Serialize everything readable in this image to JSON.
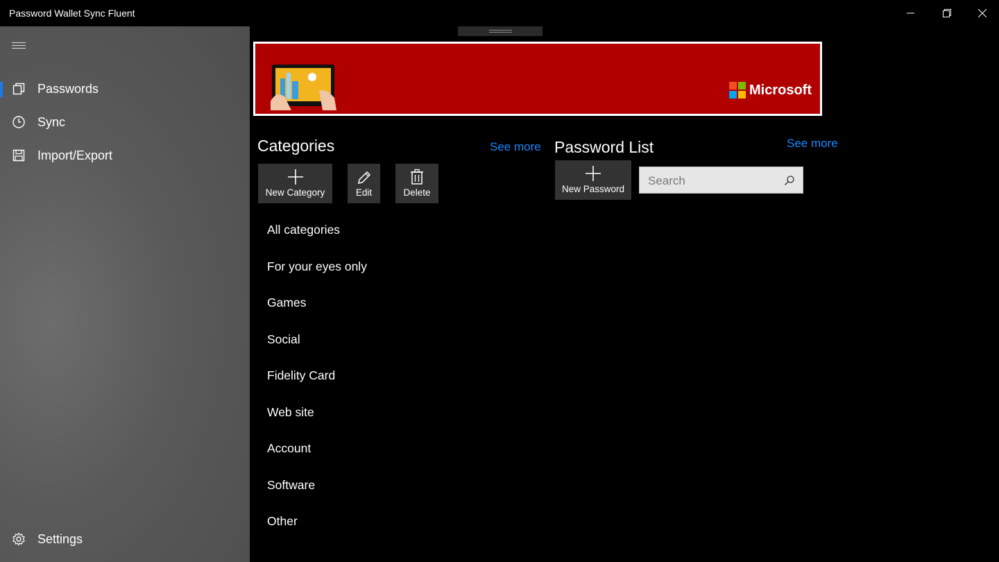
{
  "window": {
    "title": "Password Wallet Sync Fluent"
  },
  "sidebar": {
    "items": [
      {
        "label": "Passwords",
        "icon": "passwords-icon",
        "selected": true
      },
      {
        "label": "Sync",
        "icon": "clock-icon"
      },
      {
        "label": "Import/Export",
        "icon": "save-icon"
      }
    ],
    "settings_label": "Settings"
  },
  "ad": {
    "brand": "Microsoft"
  },
  "categories": {
    "title": "Categories",
    "see_more": "See more",
    "new_label": "New Category",
    "edit_label": "Edit",
    "delete_label": "Delete",
    "items": [
      "All categories",
      "For your eyes only",
      "Games",
      "Social",
      "Fidelity Card",
      "Web site",
      "Account",
      "Software",
      "Other"
    ]
  },
  "password_list": {
    "title": "Password List",
    "see_more": "See more",
    "new_label": "New Password",
    "search_placeholder": "Search"
  },
  "colors": {
    "accent": "#1a7ce6",
    "link": "#1a88ff",
    "banner": "#b00000"
  }
}
